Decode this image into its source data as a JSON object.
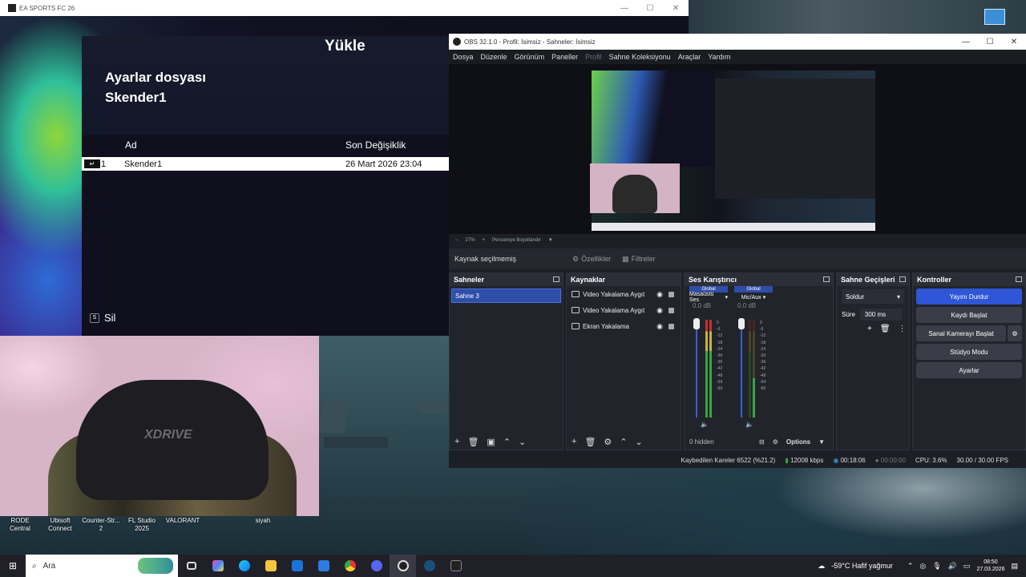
{
  "fc_window": {
    "title": "EA SPORTS FC 26",
    "heading": "Yükle",
    "subtitle_line1": "Ayarlar dosyası",
    "subtitle_line2": "Skender1",
    "col_name": "Ad",
    "col_modified": "Son Değişiklik",
    "row_index": "1",
    "row_name": "Skender1",
    "row_date": "26 Mart 2026 23:04",
    "delete_key": "S",
    "delete_label": "Sil"
  },
  "webcam": {
    "logo_text": "XDRIVE"
  },
  "obs": {
    "title": "OBS 32.1.0 - Profil: İsimsiz - Sahneler: İsimsiz",
    "menu": [
      "Dosya",
      "Düzenle",
      "Görünüm",
      "Paneller",
      "Profil",
      "Sahne Koleksiyonu",
      "Araçlar",
      "Yardım"
    ],
    "zoom": "27%",
    "zoom_mode": "Pencereye Boyutlandır",
    "no_source": "Kaynak seçilmemiş",
    "properties": "Özellikler",
    "filters": "Filtreler",
    "scenes_title": "Sahneler",
    "scene_active": "Sahne 3",
    "sources_title": "Kaynaklar",
    "sources": [
      "Video Yakalama Aygıt",
      "Video Yakalama Aygıt",
      "Ekran Yakalama"
    ],
    "mixer_title": "Ses Karıştırıcı",
    "mixer": [
      {
        "tag": "Global",
        "name": "Masaüstü Ses",
        "db": "0.0 dB"
      },
      {
        "tag": "Global",
        "name": "Mic/Aux",
        "db": "0.0 dB"
      }
    ],
    "mixer_ticks": [
      "0",
      "-6",
      "-12",
      "-18",
      "-24",
      "-30",
      "-36",
      "-42",
      "-48",
      "-54",
      "-60"
    ],
    "mixer_hidden": "0 hidden",
    "mixer_options": "Options",
    "transitions_title": "Sahne Geçişleri",
    "transition": "Soldur",
    "duration_label": "Süre",
    "duration": "300 ms",
    "controls_title": "Kontroller",
    "controls": [
      "Yayını Durdur",
      "Kaydı Başlat",
      "Sanal Kamerayı Başlat",
      "Stüdyo Modu",
      "Ayarlar"
    ],
    "status": {
      "dropped": "Kaybedilen Kareler 6522 (%21.2)",
      "bitrate": "12008 kbps",
      "stream_time": "00:18:06",
      "rec_time": "00:00:00",
      "cpu": "CPU: 3.6%",
      "fps": "30.00 / 30.00 FPS"
    }
  },
  "desktop_shortcuts": [
    {
      "label": "RODE Central"
    },
    {
      "label": "Ubisoft Connect"
    },
    {
      "label": "Counter-Str... 2"
    },
    {
      "label": "FL Studio 2025"
    },
    {
      "label": "VALORANT"
    },
    {
      "label": "siyah"
    }
  ],
  "taskbar": {
    "search_placeholder": "Ara",
    "weather": "-59°C  Hafif yağmur",
    "time": "08:50",
    "date": "27.03.2026"
  },
  "colors": {
    "obs_accent": "#2f56d6",
    "obs_bg": "#1d1f26",
    "fc_bg": "#0f0f1d"
  }
}
